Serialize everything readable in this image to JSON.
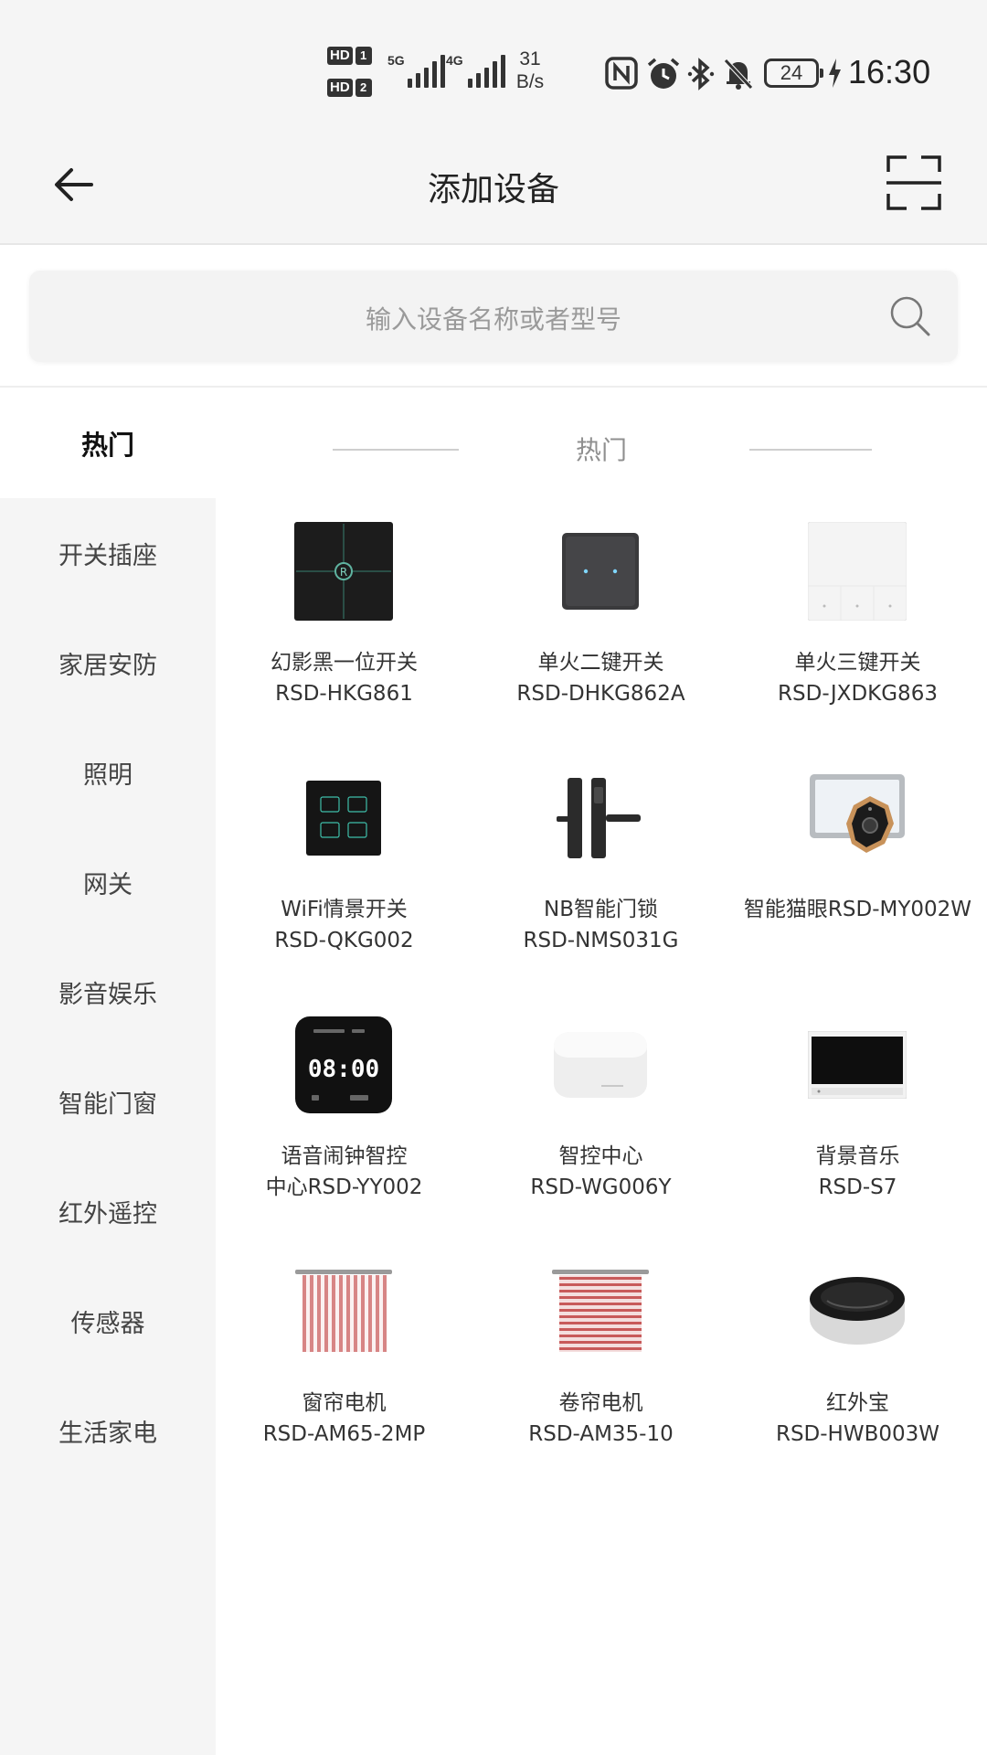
{
  "status_bar": {
    "hd1": "HD",
    "hd1_num": "1",
    "hd2": "HD",
    "hd2_num": "2",
    "sig1_label": "5G",
    "sig2_label": "4G",
    "net_speed_value": "31",
    "net_speed_unit": "B/s",
    "battery": "24",
    "time": "16:30",
    "icons": [
      "nfc-icon",
      "alarm-icon",
      "bluetooth-icon",
      "mute-bell-icon",
      "charging-icon"
    ]
  },
  "header": {
    "title": "添加设备",
    "back_icon": "arrow-left-icon",
    "scan_icon": "scan-icon"
  },
  "search": {
    "placeholder": "输入设备名称或者型号",
    "icon": "search-icon"
  },
  "sidebar": {
    "items": [
      {
        "label": "热门",
        "active": true
      },
      {
        "label": "开关插座",
        "active": false
      },
      {
        "label": "家居安防",
        "active": false
      },
      {
        "label": "照明",
        "active": false
      },
      {
        "label": "网关",
        "active": false
      },
      {
        "label": "影音娱乐",
        "active": false
      },
      {
        "label": "智能门窗",
        "active": false
      },
      {
        "label": "红外遥控",
        "active": false
      },
      {
        "label": "传感器",
        "active": false
      },
      {
        "label": "生活家电",
        "active": false
      }
    ]
  },
  "section": {
    "title": "热门"
  },
  "devices": [
    {
      "name": "幻影黑一位开关",
      "model": "RSD-HKG861",
      "image": "black-switch-image"
    },
    {
      "name": "单火二键开关",
      "model": "RSD-DHKG862A",
      "image": "two-key-switch-image"
    },
    {
      "name": "单火三键开关",
      "model": "RSD-JXDKG863",
      "image": "three-key-switch-image"
    },
    {
      "name": "WiFi情景开关",
      "model": "RSD-QKG002",
      "image": "scene-switch-image"
    },
    {
      "name": "NB智能门锁",
      "model": "RSD-NMS031G",
      "image": "door-lock-image"
    },
    {
      "name": "智能猫眼RSD-MY002W",
      "model": "",
      "image": "peephole-camera-image"
    },
    {
      "name": "语音闹钟智控",
      "model": "中心RSD-YY002",
      "image": "alarm-clock-hub-image",
      "clock_text": "08:00"
    },
    {
      "name": "智控中心",
      "model": "RSD-WG006Y",
      "image": "gateway-hub-image"
    },
    {
      "name": "背景音乐",
      "model": "RSD-S7",
      "image": "background-music-panel-image"
    },
    {
      "name": "窗帘电机",
      "model": "RSD-AM65-2MP",
      "image": "curtain-motor-image"
    },
    {
      "name": "卷帘电机",
      "model": "RSD-AM35-10",
      "image": "roller-blind-motor-image"
    },
    {
      "name": "红外宝",
      "model": "RSD-HWB003W",
      "image": "ir-blaster-image"
    }
  ],
  "colors": {
    "background": "#f5f5f5",
    "text": "#222222",
    "muted": "#9a9a9a",
    "curtain_red": "#c85a5a"
  }
}
